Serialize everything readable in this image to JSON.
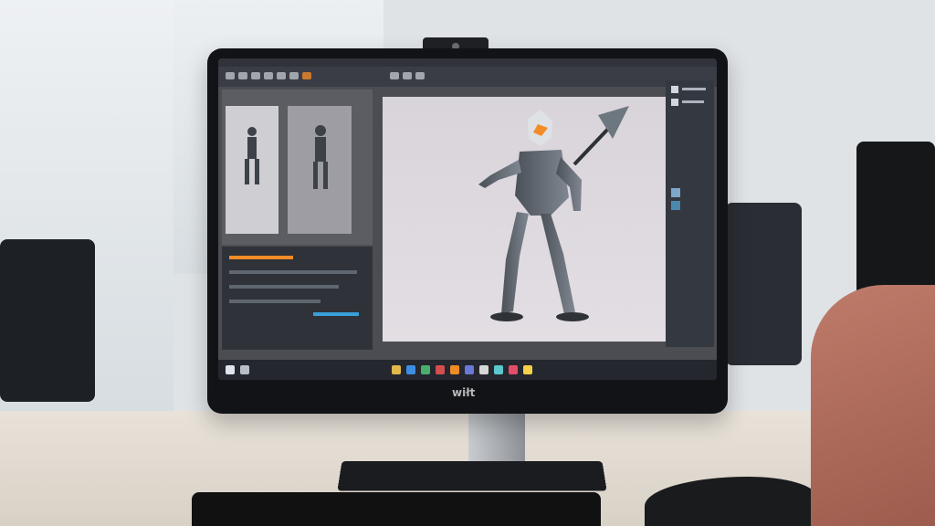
{
  "scene": {
    "type": "office desk computer setup",
    "accent": "#f28c28",
    "screen_background": "#4b4d52",
    "canvas_background": "#ddd9df",
    "ui_dark": "#30333a"
  },
  "monitor": {
    "brand": "wiłt"
  },
  "taskbar": {
    "icons": [
      "start-icon",
      "search-icon",
      "folder-icon",
      "browser-icon",
      "app-icon",
      "app-icon",
      "app-icon",
      "app-icon",
      "app-icon",
      "app-icon",
      "app-icon",
      "app-icon",
      "app-icon",
      "app-icon"
    ]
  }
}
